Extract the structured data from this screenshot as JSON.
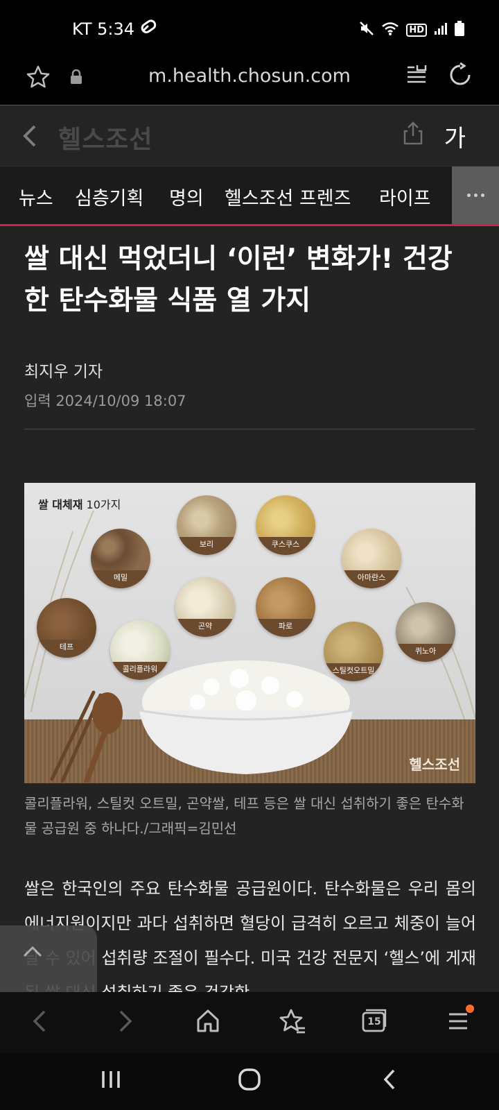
{
  "status": {
    "carrier_time": "KT 5:34",
    "network_badge": "HD",
    "icons": [
      "mute-icon",
      "wifi-icon",
      "signal-icon",
      "battery-icon"
    ]
  },
  "browser": {
    "url": "m.health.chosun.com"
  },
  "site": {
    "logo": "헬스조선",
    "font_size_label": "가"
  },
  "nav": {
    "tabs": [
      "뉴스",
      "심층기획",
      "명의",
      "헬스조선 프렌즈",
      "라이프"
    ]
  },
  "article": {
    "title_line1": "쌀 대신 먹었더니 ‘이런’ 변화가! 건강",
    "title_line2": "한 탄수화물 식품 열 가지",
    "author": "최지우 기자",
    "published": "입력 2024/10/09 18:07",
    "figure": {
      "title_bold": "쌀 대체재",
      "title_rest": "10가지",
      "items": [
        "메밀",
        "보리",
        "쿠스쿠스",
        "아마란스",
        "테프",
        "콜리플라워",
        "곤약",
        "파로",
        "스틸컷오트밀",
        "퀴노아"
      ],
      "watermark": "헬스조선"
    },
    "caption": "콜리플라워, 스틸컷 오트밀, 곤약쌀, 테프 등은 쌀 대신 섭취하기 좋은 탄수화물 공급원 중 하나다./그래픽=김민선",
    "body": "쌀은 한국인의 주요 탄수화물 공급원이다. 탄수화물은 우리 몸의 에너지원이지만 과다 섭취하면 혈당이 급격히 오르고 체중이 늘어날 수 있어 섭취량 조절이 필수다. 미국 건강 전문지 ‘헬스’에 게재된 쌀 대신 섭취하기 좋은 건강한"
  },
  "bottom_bar": {
    "tab_count": "15"
  },
  "colors": {
    "accent": "#c8254a",
    "notification_dot": "#ff6a2b"
  }
}
